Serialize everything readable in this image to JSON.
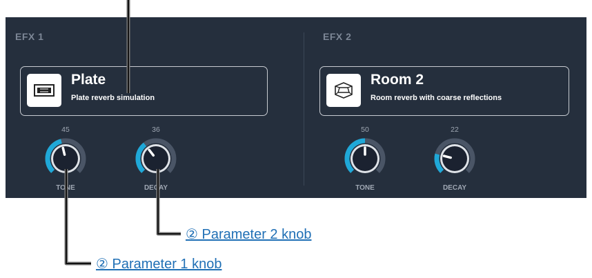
{
  "efx1": {
    "label": "EFX 1",
    "effect_name": "Plate",
    "description": "Plate reverb simulation",
    "icon": "plate-reverb-icon",
    "knobs": [
      {
        "label": "TONE",
        "value": "45"
      },
      {
        "label": "DECAY",
        "value": "36"
      }
    ]
  },
  "efx2": {
    "label": "EFX 2",
    "effect_name": "Room 2",
    "description": "Room reverb with coarse reflections",
    "icon": "room-reverb-icon",
    "knobs": [
      {
        "label": "TONE",
        "value": "50"
      },
      {
        "label": "DECAY",
        "value": "22"
      }
    ]
  },
  "callouts": {
    "param2": "② Parameter 2 knob",
    "param1": "② Parameter 1 knob"
  },
  "colors": {
    "panel_bg": "#252f3d",
    "knob_accent": "#1fa8d8",
    "knob_track": "#4a5566",
    "callout_text": "#1f6fb5"
  }
}
